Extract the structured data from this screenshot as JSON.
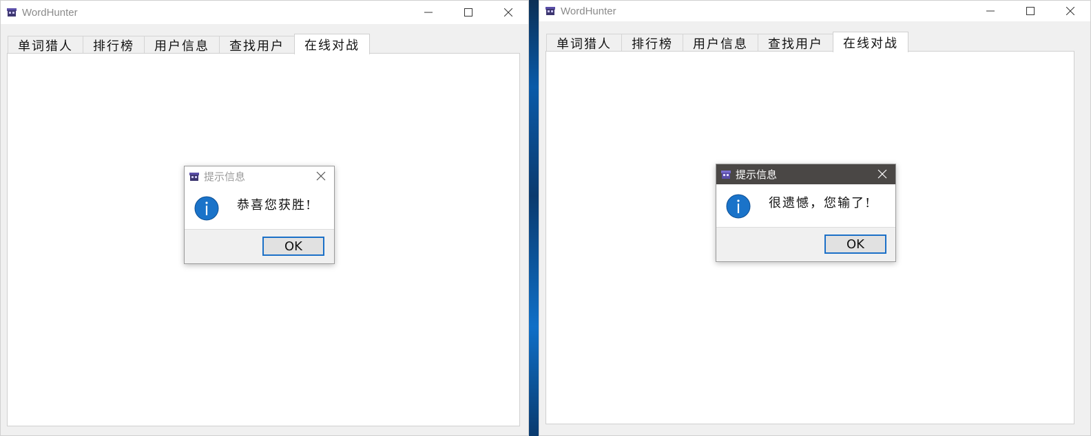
{
  "windows": {
    "left": {
      "title": "WordHunter",
      "tabs": [
        "单词猎人",
        "排行榜",
        "用户信息",
        "查找用户",
        "在线对战"
      ],
      "active_tab": "在线对战",
      "dialog": {
        "title": "提示信息",
        "message": "恭喜您获胜!",
        "ok_label": "OK",
        "icon": "info-icon"
      }
    },
    "right": {
      "title": "WordHunter",
      "tabs": [
        "单词猎人",
        "排行榜",
        "用户信息",
        "查找用户",
        "在线对战"
      ],
      "active_tab": "在线对战",
      "dialog": {
        "title": "提示信息",
        "message": "很遗憾，您输了!",
        "ok_label": "OK",
        "icon": "info-icon"
      }
    }
  },
  "colors": {
    "info_blue": "#1a73c9",
    "button_focus": "#1a6fc7",
    "dark_titlebar": "#4a4745"
  }
}
